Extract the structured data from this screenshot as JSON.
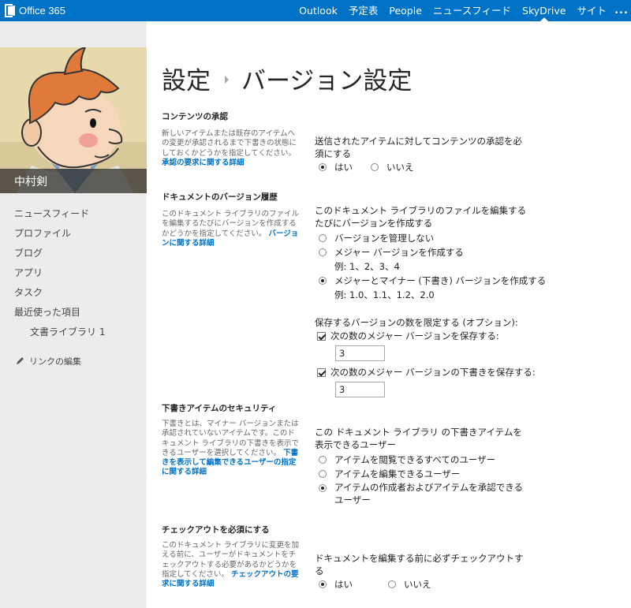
{
  "suite": {
    "brand": "Office 365",
    "nav": [
      "Outlook",
      "予定表",
      "People",
      "ニュースフィード",
      "SkyDrive",
      "サイト"
    ],
    "active": "SkyDrive",
    "more": "..."
  },
  "profile": {
    "name": "中村剣"
  },
  "quicklaunch": {
    "items": [
      "ニュースフィード",
      "プロファイル",
      "ブログ",
      "アプリ",
      "タスク",
      "最近使った項目"
    ],
    "subitem": "文書ライブラリ 1",
    "edit_links": "リンクの編集"
  },
  "page": {
    "breadcrumb_root": "設定",
    "title": "バージョン設定"
  },
  "sections": {
    "approval": {
      "title": "コンテンツの承認",
      "desc": "新しいアイテムまたは既存のアイテムへの変更が承認されるまで下書きの状態にしておくかどうかを指定してください。",
      "link": "承認の要求に関する詳細",
      "question": "送信されたアイテムに対してコンテンツの承認を必須にする",
      "yes": "はい",
      "no": "いいえ",
      "selected": "yes"
    },
    "versioning": {
      "title": "ドキュメントのバージョン履歴",
      "desc": "このドキュメント ライブラリのファイルを編集するたびにバージョンを作成するかどうかを指定してください。",
      "link": "バージョンに関する詳細",
      "question": "このドキュメント ライブラリのファイルを編集するたびにバージョンを作成する",
      "opt_none": "バージョンを管理しない",
      "opt_major": "メジャー バージョンを作成する",
      "example_major": "例: 1、2、3、4",
      "opt_minor": "メジャーとマイナー (下書き) バージョンを作成する",
      "example_minor": "例: 1.0、1.1、1.2、2.0",
      "selected": "minor",
      "limit_title": "保存するバージョンの数を限定する (オプション):",
      "keep_major_label": "次の数のメジャー バージョンを保存する:",
      "keep_major_checked": true,
      "keep_major_value": "3",
      "keep_drafts_label": "次の数のメジャー バージョンの下書きを保存する:",
      "keep_drafts_checked": true,
      "keep_drafts_value": "3"
    },
    "draft_security": {
      "title": "下書きアイテムのセキュリティ",
      "desc": "下書きとは、マイナー バージョンまたは承認されていないアイテムです。このドキュメント ライブラリの下書きを表示できるユーザーを選択してください。",
      "link": "下書きを表示して編集できるユーザーの指定に関する詳細",
      "question": "この ドキュメント ライブラリ の下書きアイテムを表示できるユーザー",
      "opt_read": "アイテムを閲覧できるすべてのユーザー",
      "opt_edit": "アイテムを編集できるユーザー",
      "opt_approve": "アイテムの作成者およびアイテムを承認できるユーザー",
      "selected": "approve"
    },
    "checkout": {
      "title": "チェックアウトを必須にする",
      "desc": "このドキュメント ライブラリに変更を加える前に、ユーザーがドキュメントをチェックアウトする必要があるかどうかを指定してください。",
      "link": "チェックアウトの要求に関する詳細",
      "question": "ドキュメントを編集する前に必ずチェックアウトする",
      "yes": "はい",
      "no": "いいえ",
      "selected": "yes"
    }
  },
  "colors": {
    "suitebar": "#0072c6",
    "link": "#0072c6",
    "leftpanel": "#ececec"
  },
  "icons": [
    "office-logo-icon",
    "pencil-icon",
    "radio-icon",
    "checkbox-icon"
  ]
}
